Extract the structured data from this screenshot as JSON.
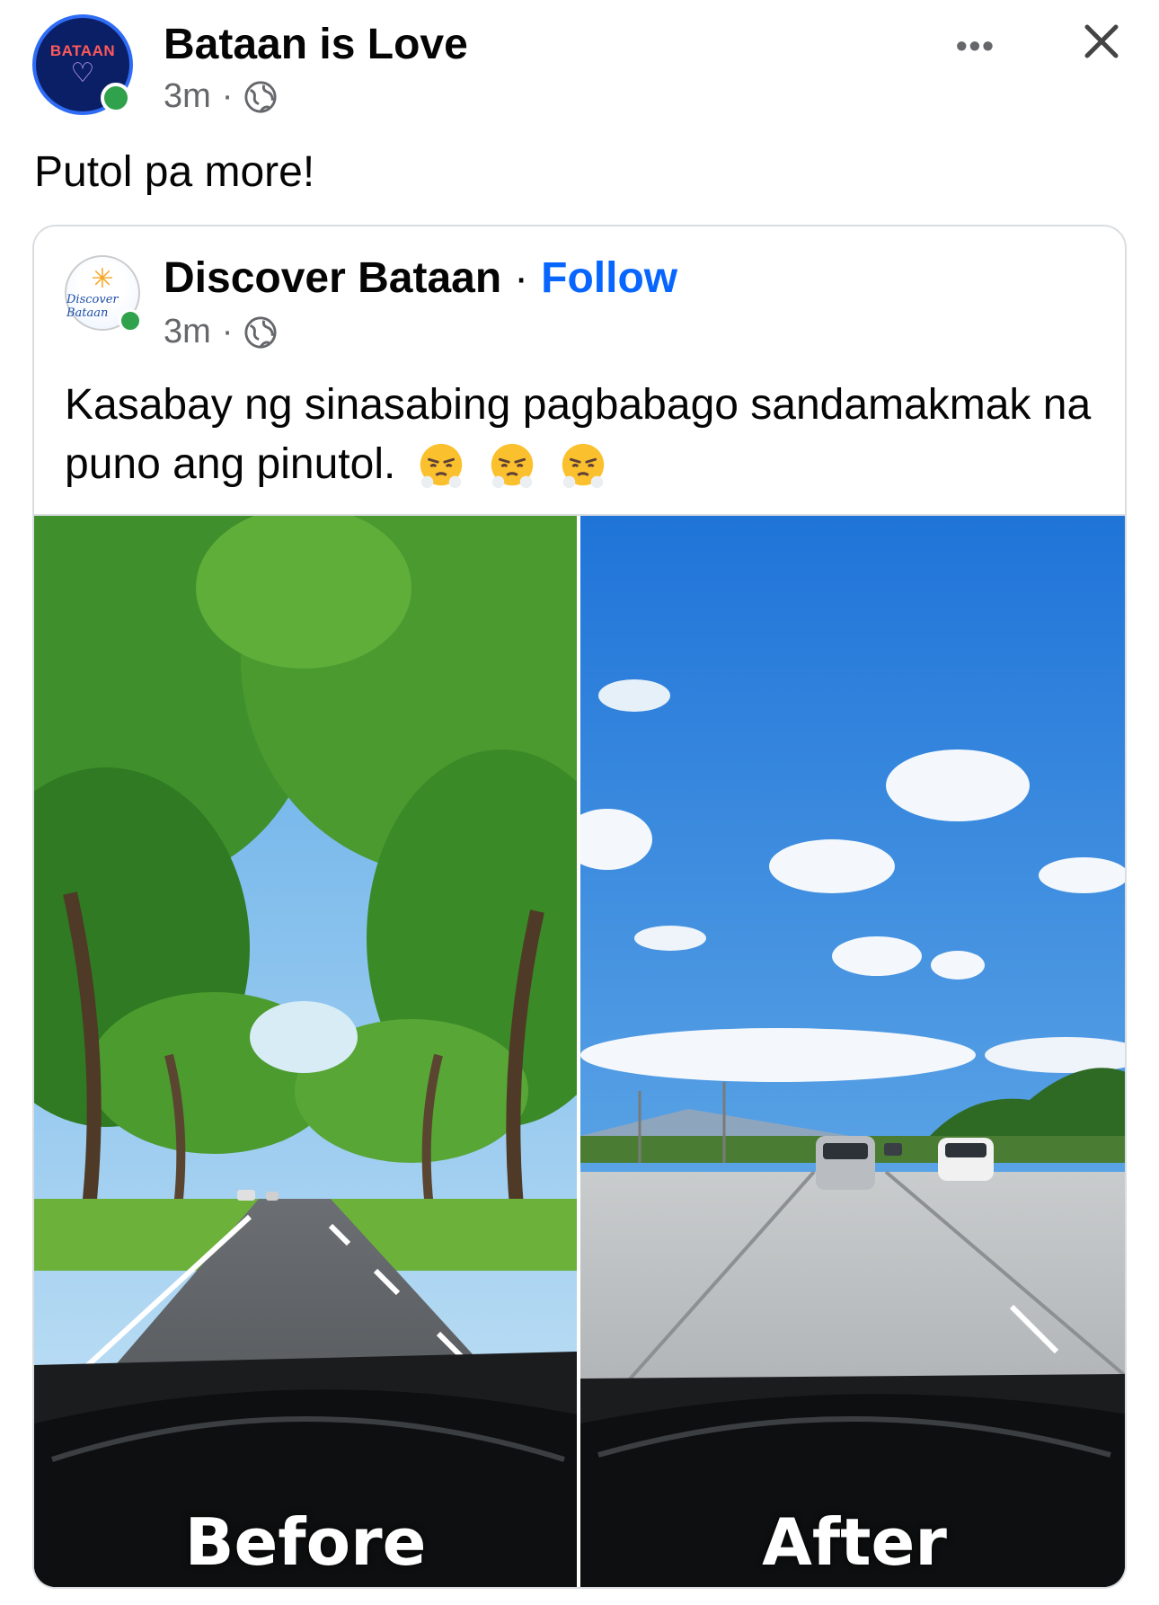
{
  "post": {
    "author": "Bataan is Love",
    "avatar_text": "BATAAN",
    "time": "3m",
    "separator": "·",
    "privacy_icon": "globe-icon",
    "text": "Putol pa more!",
    "more_label": "•••",
    "close_icon": "close-icon"
  },
  "shared": {
    "author": "Discover Bataan",
    "separator": "·",
    "follow_label": "Follow",
    "time": "3m",
    "avatar_text": "Discover Bataan",
    "text": "Kasabay ng sinasabing pagbabago sandamakmak na puno ang pinutol.",
    "emojis": [
      "face-with-steam-from-nose",
      "face-with-steam-from-nose",
      "face-with-steam-from-nose"
    ],
    "images": {
      "before_label": "Before",
      "after_label": "After"
    }
  },
  "colors": {
    "link": "#0866ff",
    "meta": "#65676b",
    "online": "#31a24c"
  }
}
